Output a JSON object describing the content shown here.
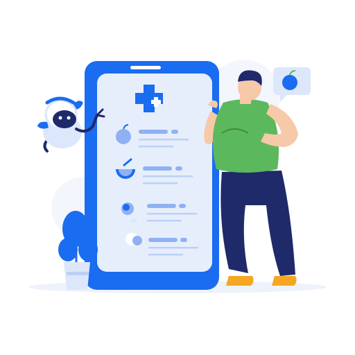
{
  "colors": {
    "brand_blue": "#1a6cf0",
    "light_blue": "#dce7fb",
    "screen_bg": "#e6eefc",
    "line_blue": "#8fb1f4",
    "shirt_green": "#5cb85c",
    "pants_navy": "#1f2a6b",
    "skin": "#f6c9a8",
    "shoe_orange": "#f5a623"
  },
  "icons": {
    "medical_cross": "medical-cross-icon",
    "apple": "apple-icon",
    "melon": "melon-slice-icon",
    "pill": "pill-icon",
    "egg": "egg-icon",
    "chat_apple": "apple-chat-bubble-icon"
  },
  "health_list_items": [
    {
      "icon": "apple-icon"
    },
    {
      "icon": "melon-slice-icon"
    },
    {
      "icon": "pill-icon"
    },
    {
      "icon": "egg-icon"
    }
  ]
}
